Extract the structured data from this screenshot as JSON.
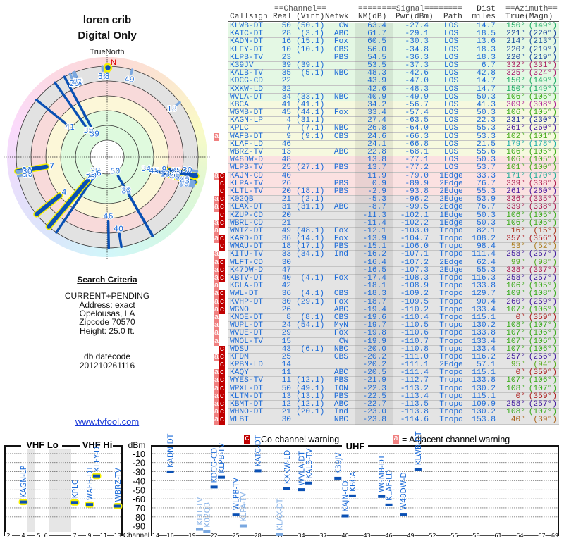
{
  "header": {
    "title": "loren crib",
    "subtitle": "Digital Only",
    "north_label": "TrueNorth",
    "north_marker": "N"
  },
  "criteria": {
    "title": "Search Criteria",
    "lines": [
      "CURRENT+PENDING",
      "Address: exact",
      "Opelousas, LA",
      "Zipcode 70570",
      "Height: 25.0 ft."
    ],
    "datecode_label": "db datecode",
    "datecode": "201210261116"
  },
  "link": "www.tvfool.com",
  "table": {
    "group_headers": {
      "channel": "==Channel==",
      "signal": "========Signal========",
      "dist": "Dist",
      "azimuth": "==Azimuth=="
    },
    "columns": [
      "Callsign",
      "Real",
      "(Virt)",
      "Netwk",
      "NM(dB)",
      "Pwr(dBm)",
      "Path",
      "miles",
      "True",
      "(Magn)"
    ],
    "band_colors": {
      "green": "#e4f8e4",
      "yellow": "#f6f9df",
      "red": "#fbe1e1",
      "mixed": "#ece3e3",
      "gray": "#e4e4e4"
    },
    "rows": [
      {
        "call": "KLWB-DT",
        "real": "50",
        "virt": "(50.1)",
        "net": "CW",
        "nm": "63.4",
        "pwr": "-27.4",
        "path": "LOS",
        "dist": "14.7",
        "az": "150°",
        "magn": "(149°)",
        "flags": "",
        "band": "green"
      },
      {
        "call": "KATC-DT",
        "real": "28",
        "virt": "(3.1)",
        "net": "ABC",
        "nm": "61.7",
        "pwr": "-29.1",
        "path": "LOS",
        "dist": "18.5",
        "az": "221°",
        "magn": "(220°)",
        "flags": "",
        "band": "green"
      },
      {
        "call": "KADN-DT",
        "real": "16",
        "virt": "(15.1)",
        "net": "Fox",
        "nm": "60.5",
        "pwr": "-30.3",
        "path": "LOS",
        "dist": "13.6",
        "az": "214°",
        "magn": "(213°)",
        "flags": "",
        "band": "green"
      },
      {
        "call": "KLFY-DT",
        "real": "10",
        "virt": "(10.1)",
        "net": "CBS",
        "nm": "56.0",
        "pwr": "-34.8",
        "path": "LOS",
        "dist": "18.3",
        "az": "220°",
        "magn": "(219°)",
        "flags": "",
        "band": "green"
      },
      {
        "call": "KLPB-TV",
        "real": "23",
        "virt": "",
        "net": "PBS",
        "nm": "54.5",
        "pwr": "-36.3",
        "path": "LOS",
        "dist": "18.3",
        "az": "220°",
        "magn": "(219°)",
        "flags": "",
        "band": "green"
      },
      {
        "call": "K39JV",
        "real": "39",
        "virt": "(39.1)",
        "net": "",
        "nm": "53.5",
        "pwr": "-37.3",
        "path": "LOS",
        "dist": "6.7",
        "az": "332°",
        "magn": "(331°)",
        "flags": "",
        "band": "green"
      },
      {
        "call": "KALB-TV",
        "real": "35",
        "virt": "(5.1)",
        "net": "NBC",
        "nm": "48.3",
        "pwr": "-42.6",
        "path": "LOS",
        "dist": "42.8",
        "az": "325°",
        "magn": "(324°)",
        "flags": "",
        "band": "green"
      },
      {
        "call": "KDCG-CD",
        "real": "22",
        "virt": "",
        "net": "",
        "nm": "43.9",
        "pwr": "-47.0",
        "path": "LOS",
        "dist": "14.7",
        "az": "150°",
        "magn": "(149°)",
        "flags": "",
        "band": "green"
      },
      {
        "call": "KXKW-LD",
        "real": "32",
        "virt": "",
        "net": "",
        "nm": "42.6",
        "pwr": "-48.3",
        "path": "LOS",
        "dist": "14.7",
        "az": "150°",
        "magn": "(149°)",
        "flags": "",
        "band": "green"
      },
      {
        "call": "WVLA-DT",
        "real": "34",
        "virt": "(33.1)",
        "net": "NBC",
        "nm": "40.9",
        "pwr": "-49.9",
        "path": "LOS",
        "dist": "50.3",
        "az": "106°",
        "magn": "(105°)",
        "flags": "",
        "band": "green"
      },
      {
        "call": "KBCA",
        "real": "41",
        "virt": "(41.1)",
        "net": "",
        "nm": "34.2",
        "pwr": "-56.7",
        "path": "LOS",
        "dist": "41.3",
        "az": "309°",
        "magn": "(308°)",
        "flags": "",
        "band": "yellow"
      },
      {
        "call": "WGMB-DT",
        "real": "45",
        "virt": "(44.1)",
        "net": "Fox",
        "nm": "33.4",
        "pwr": "-57.4",
        "path": "LOS",
        "dist": "50.3",
        "az": "106°",
        "magn": "(105°)",
        "flags": "",
        "band": "yellow"
      },
      {
        "call": "KAGN-LP",
        "real": "4",
        "virt": "(31.1)",
        "net": "",
        "nm": "27.4",
        "pwr": "-63.5",
        "path": "LOS",
        "dist": "22.3",
        "az": "231°",
        "magn": "(230°)",
        "flags": "",
        "band": "yellow"
      },
      {
        "call": "KPLC",
        "real": "7",
        "virt": "(7.1)",
        "net": "NBC",
        "nm": "26.8",
        "pwr": "-64.0",
        "path": "LOS",
        "dist": "55.3",
        "az": "261°",
        "magn": "(260°)",
        "flags": "",
        "band": "yellow"
      },
      {
        "call": "WAFB-DT",
        "real": "9",
        "virt": "(9.1)",
        "net": "CBS",
        "nm": "24.6",
        "pwr": "-66.3",
        "path": "LOS",
        "dist": "53.3",
        "az": "102°",
        "magn": "(101°)",
        "flags": "a",
        "band": "yellow"
      },
      {
        "call": "KLAF-LD",
        "real": "46",
        "virt": "",
        "net": "",
        "nm": "24.1",
        "pwr": "-66.8",
        "path": "LOS",
        "dist": "21.5",
        "az": "179°",
        "magn": "(178°)",
        "flags": "",
        "band": "yellow"
      },
      {
        "call": "WBRZ-TV",
        "real": "13",
        "virt": "",
        "net": "ABC",
        "nm": "22.8",
        "pwr": "-68.1",
        "path": "LOS",
        "dist": "55.6",
        "az": "106°",
        "magn": "(105°)",
        "flags": "",
        "band": "yellow"
      },
      {
        "call": "W48DW-D",
        "real": "48",
        "virt": "",
        "net": "",
        "nm": "13.8",
        "pwr": "-77.1",
        "path": "LOS",
        "dist": "50.3",
        "az": "106°",
        "magn": "(105°)",
        "flags": "",
        "band": "red"
      },
      {
        "call": "WLPB-TV",
        "real": "25",
        "virt": "(27.1)",
        "net": "PBS",
        "nm": "13.7",
        "pwr": "-77.2",
        "path": "LOS",
        "dist": "53.7",
        "az": "101°",
        "magn": "(100°)",
        "flags": "",
        "band": "red"
      },
      {
        "call": "KAJN-CD",
        "real": "40",
        "virt": "",
        "net": "",
        "nm": "11.9",
        "pwr": "-79.0",
        "path": "1Edge",
        "dist": "33.3",
        "az": "171°",
        "magn": "(170°)",
        "flags": "ac",
        "band": "red"
      },
      {
        "call": "KLPA-TV",
        "real": "26",
        "virt": "",
        "net": "PBS",
        "nm": "0.9",
        "pwr": "-89.9",
        "path": "2Edge",
        "dist": "76.7",
        "az": "339°",
        "magn": "(338°)",
        "flags": "c",
        "band": "red"
      },
      {
        "call": "KLTL-TV",
        "real": "20",
        "virt": "(18.1)",
        "net": "PBS",
        "nm": "-2.9",
        "pwr": "-93.8",
        "path": "2Edge",
        "dist": "55.3",
        "az": "261°",
        "magn": "(260°)",
        "flags": "c",
        "band": "red"
      },
      {
        "call": "K02QB",
        "real": "21",
        "virt": "(2.1)",
        "net": "",
        "nm": "-5.3",
        "pwr": "-96.2",
        "path": "2Edge",
        "dist": "53.9",
        "az": "336°",
        "magn": "(335°)",
        "flags": "ac",
        "band": "mixed"
      },
      {
        "call": "KLAX-DT",
        "real": "31",
        "virt": "(31.1)",
        "net": "ABC",
        "nm": "-8.7",
        "pwr": "-99.5",
        "path": "2Edge",
        "dist": "76.7",
        "az": "339°",
        "magn": "(338°)",
        "flags": "ac",
        "band": "gray"
      },
      {
        "call": "KZUP-CD",
        "real": "20",
        "virt": "",
        "net": "",
        "nm": "-11.3",
        "pwr": "-102.1",
        "path": "1Edge",
        "dist": "50.3",
        "az": "106°",
        "magn": "(105°)",
        "flags": "c",
        "band": "gray"
      },
      {
        "call": "WBRL-CD",
        "real": "21",
        "virt": "",
        "net": "",
        "nm": "-11.4",
        "pwr": "-102.2",
        "path": "1Edge",
        "dist": "50.3",
        "az": "106°",
        "magn": "(105°)",
        "flags": "ac",
        "band": "gray"
      },
      {
        "call": "WNTZ-DT",
        "real": "49",
        "virt": "(48.1)",
        "net": "Fox",
        "nm": "-12.1",
        "pwr": "-103.0",
        "path": "Tropo",
        "dist": "82.1",
        "az": "16°",
        "magn": "(15°)",
        "flags": "a",
        "band": "gray"
      },
      {
        "call": "KARD-DT",
        "real": "36",
        "virt": "(14.1)",
        "net": "Fox",
        "nm": "-13.9",
        "pwr": "-104.7",
        "path": "Tropo",
        "dist": "108.2",
        "az": "357°",
        "magn": "(356°)",
        "flags": "ac",
        "band": "gray"
      },
      {
        "call": "WMAU-DT",
        "real": "18",
        "virt": "(17.1)",
        "net": "PBS",
        "nm": "-15.1",
        "pwr": "-106.0",
        "path": "Tropo",
        "dist": "98.4",
        "az": "53°",
        "magn": "(52°)",
        "flags": "c",
        "band": "gray"
      },
      {
        "call": "KITU-TV",
        "real": "33",
        "virt": "(34.1)",
        "net": "Ind",
        "nm": "-16.2",
        "pwr": "-107.1",
        "path": "Tropo",
        "dist": "111.4",
        "az": "258°",
        "magn": "(257°)",
        "flags": "a",
        "band": "gray"
      },
      {
        "call": "WLFT-CD",
        "real": "30",
        "virt": "",
        "net": "",
        "nm": "-16.4",
        "pwr": "-107.2",
        "path": "2Edge",
        "dist": "62.4",
        "az": "99°",
        "magn": "(98°)",
        "flags": "ac",
        "band": "gray"
      },
      {
        "call": "K47DW-D",
        "real": "47",
        "virt": "",
        "net": "",
        "nm": "-16.5",
        "pwr": "-107.3",
        "path": "2Edge",
        "dist": "55.3",
        "az": "338°",
        "magn": "(337°)",
        "flags": "ac",
        "band": "gray"
      },
      {
        "call": "KBTV-DT",
        "real": "40",
        "virt": "(4.1)",
        "net": "Fox",
        "nm": "-17.4",
        "pwr": "-108.3",
        "path": "Tropo",
        "dist": "116.3",
        "az": "258°",
        "magn": "(257°)",
        "flags": "ac",
        "band": "gray"
      },
      {
        "call": "KGLA-DT",
        "real": "42",
        "virt": "",
        "net": "",
        "nm": "-18.1",
        "pwr": "-108.9",
        "path": "Tropo",
        "dist": "133.8",
        "az": "106°",
        "magn": "(105°)",
        "flags": "a",
        "band": "gray"
      },
      {
        "call": "WWL-DT",
        "real": "36",
        "virt": "(4.1)",
        "net": "CBS",
        "nm": "-18.3",
        "pwr": "-109.2",
        "path": "Tropo",
        "dist": "129.7",
        "az": "109°",
        "magn": "(108°)",
        "flags": "ac",
        "band": "gray"
      },
      {
        "call": "KVHP-DT",
        "real": "30",
        "virt": "(29.1)",
        "net": "Fox",
        "nm": "-18.7",
        "pwr": "-109.5",
        "path": "Tropo",
        "dist": "90.4",
        "az": "260°",
        "magn": "(259°)",
        "flags": "ac",
        "band": "gray"
      },
      {
        "call": "WGNO",
        "real": "26",
        "virt": "",
        "net": "ABC",
        "nm": "-19.4",
        "pwr": "-110.2",
        "path": "Tropo",
        "dist": "133.4",
        "az": "107°",
        "magn": "(106°)",
        "flags": "ac",
        "band": "gray"
      },
      {
        "call": "KNOE-DT",
        "real": "8",
        "virt": "(8.1)",
        "net": "CBS",
        "nm": "-19.6",
        "pwr": "-110.4",
        "path": "Tropo",
        "dist": "115.1",
        "az": "0°",
        "magn": "(359°)",
        "flags": "a",
        "band": "gray"
      },
      {
        "call": "WUPL-DT",
        "real": "24",
        "virt": "(54.1)",
        "net": "MyN",
        "nm": "-19.7",
        "pwr": "-110.5",
        "path": "Tropo",
        "dist": "130.2",
        "az": "108°",
        "magn": "(107°)",
        "flags": "a",
        "band": "gray"
      },
      {
        "call": "WVUE-DT",
        "real": "29",
        "virt": "",
        "net": "Fox",
        "nm": "-19.8",
        "pwr": "-110.6",
        "path": "Tropo",
        "dist": "133.8",
        "az": "107°",
        "magn": "(106°)",
        "flags": "a",
        "band": "gray"
      },
      {
        "call": "WNOL-TV",
        "real": "15",
        "virt": "",
        "net": "CW",
        "nm": "-19.9",
        "pwr": "-110.7",
        "path": "Tropo",
        "dist": "133.4",
        "az": "107°",
        "magn": "(106°)",
        "flags": "a",
        "band": "gray"
      },
      {
        "call": "WDSU",
        "real": "43",
        "virt": "(6.1)",
        "net": "NBC",
        "nm": "-20.0",
        "pwr": "-110.8",
        "path": "Tropo",
        "dist": "133.4",
        "az": "107°",
        "magn": "(106°)",
        "flags": "c",
        "band": "gray"
      },
      {
        "call": "KFDM",
        "real": "25",
        "virt": "",
        "net": "CBS",
        "nm": "-20.2",
        "pwr": "-111.0",
        "path": "Tropo",
        "dist": "116.2",
        "az": "257°",
        "magn": "(256°)",
        "flags": "ac",
        "band": "gray"
      },
      {
        "call": "KPBN-LD",
        "real": "14",
        "virt": "",
        "net": "",
        "nm": "-20.2",
        "pwr": "-111.1",
        "path": "2Edge",
        "dist": "57.1",
        "az": "95°",
        "magn": "(94°)",
        "flags": "c",
        "band": "gray"
      },
      {
        "call": "KAQY",
        "real": "11",
        "virt": "",
        "net": "ABC",
        "nm": "-20.5",
        "pwr": "-111.4",
        "path": "Tropo",
        "dist": "115.1",
        "az": "0°",
        "magn": "(359°)",
        "flags": "ac",
        "band": "gray"
      },
      {
        "call": "WYES-TV",
        "real": "11",
        "virt": "(12.1)",
        "net": "PBS",
        "nm": "-21.9",
        "pwr": "-112.7",
        "path": "Tropo",
        "dist": "133.8",
        "az": "107°",
        "magn": "(106°)",
        "flags": "ac",
        "band": "gray"
      },
      {
        "call": "WPXL-DT",
        "real": "50",
        "virt": "(49.1)",
        "net": "ION",
        "nm": "-22.3",
        "pwr": "-113.2",
        "path": "Tropo",
        "dist": "130.2",
        "az": "108°",
        "magn": "(107°)",
        "flags": "ac",
        "band": "gray"
      },
      {
        "call": "KLTM-DT",
        "real": "13",
        "virt": "(13.1)",
        "net": "PBS",
        "nm": "-22.5",
        "pwr": "-113.4",
        "path": "Tropo",
        "dist": "115.1",
        "az": "0°",
        "magn": "(359°)",
        "flags": "ac",
        "band": "gray"
      },
      {
        "call": "KBMT-DT",
        "real": "12",
        "virt": "(12.1)",
        "net": "ABC",
        "nm": "-22.7",
        "pwr": "-113.5",
        "path": "Tropo",
        "dist": "109.9",
        "az": "258°",
        "magn": "(257°)",
        "flags": "ac",
        "band": "gray"
      },
      {
        "call": "WHNO-DT",
        "real": "21",
        "virt": "(20.1)",
        "net": "Ind",
        "nm": "-23.0",
        "pwr": "-113.8",
        "path": "Tropo",
        "dist": "130.2",
        "az": "108°",
        "magn": "(107°)",
        "flags": "ac",
        "band": "gray"
      },
      {
        "call": "WLBT",
        "real": "30",
        "virt": "",
        "net": "NBC",
        "nm": "-23.8",
        "pwr": "-114.6",
        "path": "Tropo",
        "dist": "153.8",
        "az": "40°",
        "magn": "(39°)",
        "flags": "ac",
        "band": "gray"
      }
    ]
  },
  "flags": {
    "a": "a",
    "c": "c"
  },
  "spectrum": {
    "vhf_lo": "VHF Lo",
    "vhf_hi": "VHF Hi",
    "uhf": "UHF",
    "unit": "dBm",
    "channel_label": "Channel",
    "dbm_ticks": [
      "-10",
      "-20",
      "-30",
      "-40",
      "-50",
      "-60",
      "-70",
      "-80",
      "-90"
    ],
    "vhf_ticks": [
      "2",
      "4",
      "5",
      "6",
      "7",
      "9",
      "11",
      "13"
    ],
    "uhf_ticks": [
      "14",
      "16",
      "19",
      "22",
      "25",
      "28",
      "31",
      "34",
      "37",
      "40",
      "43",
      "46",
      "49",
      "52",
      "55",
      "58",
      "61",
      "64",
      "67",
      "69"
    ],
    "cochannel_legend": "Co-channel warning",
    "adjacent_legend": "= Adjacent channel warning",
    "marker_color": "#0a50b4",
    "weak_marker_color": "#7aa8e0",
    "vhf_halo": "#f4f000"
  }
}
